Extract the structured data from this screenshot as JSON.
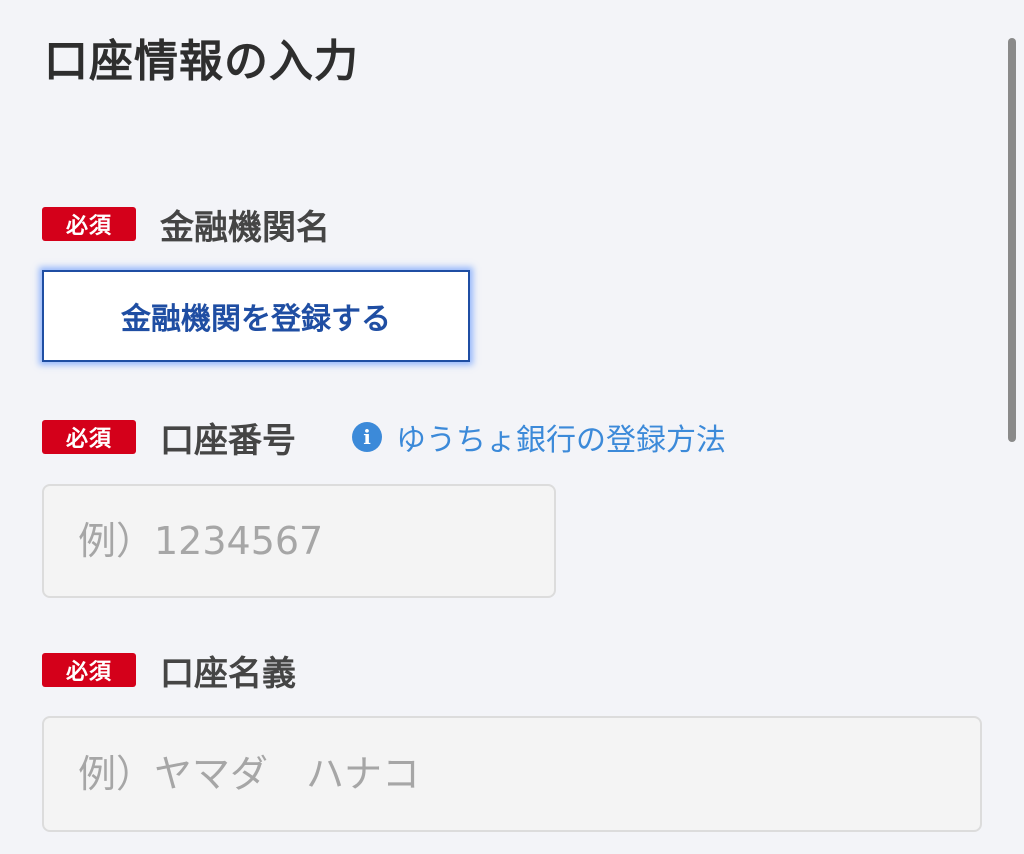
{
  "page": {
    "title": "口座情報の入力"
  },
  "required_badge": "必須",
  "fields": {
    "bank_name": {
      "label": "金融機関名",
      "button_label": "金融機関を登録する"
    },
    "account_number": {
      "label": "口座番号",
      "help_link": "ゆうちょ銀行の登録方法",
      "help_icon": "i",
      "value": "",
      "placeholder": "例）1234567"
    },
    "account_holder": {
      "label": "口座名義",
      "value": "",
      "placeholder": "例）ヤマダ　ハナコ"
    }
  },
  "colors": {
    "required_badge": "#d4001a",
    "button_border": "#1f4ea3",
    "link": "#3c8ad9",
    "background": "#f3f4f8"
  }
}
